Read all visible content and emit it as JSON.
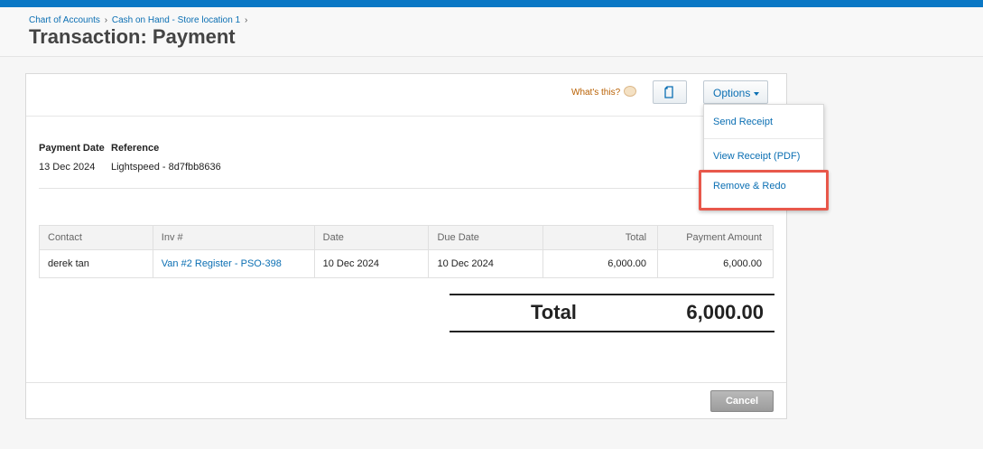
{
  "breadcrumb": {
    "item1": "Chart of Accounts",
    "item2": "Cash on Hand - Store location 1",
    "separator": "›"
  },
  "page_title": "Transaction: Payment",
  "toolbar": {
    "whats_this": "What's this?",
    "options_label": "Options",
    "doc_icon": "document-icon"
  },
  "menu": {
    "items": [
      "Send Receipt",
      "View Receipt (PDF)",
      "Remove & Redo"
    ],
    "highlight_color": "#e8584b"
  },
  "details": {
    "payment_date_label": "Payment Date",
    "reference_label": "Reference",
    "payment_date": "13 Dec 2024",
    "reference": "Lightspeed - 8d7fbb8636"
  },
  "table": {
    "headers": [
      "Contact",
      "Inv #",
      "Date",
      "Due Date",
      "Total",
      "Payment Amount"
    ],
    "rows": [
      {
        "contact": "derek tan",
        "invoice": "Van #2 Register - PSO-398",
        "date": "10 Dec 2024",
        "due_date": "10 Dec 2024",
        "total": "6,000.00",
        "payment_amount": "6,000.00"
      }
    ]
  },
  "totals": {
    "label": "Total",
    "value": "6,000.00"
  },
  "actions": {
    "cancel_label": "Cancel"
  },
  "colors": {
    "accent": "#0b78c5",
    "link": "#0b6fb3"
  }
}
